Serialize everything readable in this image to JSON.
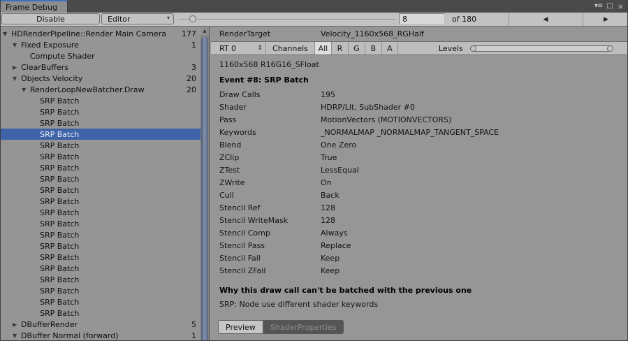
{
  "window": {
    "tab_title": "Frame Debug",
    "controls": {
      "menu": "▾≡",
      "maximize": "□",
      "close": "×"
    }
  },
  "icons": {
    "up_arrow": "▲",
    "prev": "◀",
    "next": "▶",
    "dropdown": "▾",
    "updown": "⇕"
  },
  "toolbar": {
    "disable_label": "Disable",
    "editor_label": "Editor",
    "frame_value": "8",
    "frame_total_label": "of 180",
    "slider": {
      "value": 8,
      "max": 180
    }
  },
  "tree": {
    "items": [
      {
        "label": "HDRenderPipeline::Render Main Camera",
        "count": "177",
        "level": 0,
        "arrow": "▼"
      },
      {
        "label": "Fixed Exposure",
        "count": "1",
        "level": 1,
        "arrow": "▼"
      },
      {
        "label": "Compute Shader",
        "count": "",
        "level": 2,
        "arrow": ""
      },
      {
        "label": "ClearBuffers",
        "count": "3",
        "level": 1,
        "arrow": "▶"
      },
      {
        "label": "Objects Velocity",
        "count": "20",
        "level": 1,
        "arrow": "▼"
      },
      {
        "label": "RenderLoopNewBatcher.Draw",
        "count": "20",
        "level": 2,
        "arrow": "▼"
      },
      {
        "label": "SRP Batch",
        "count": "",
        "level": 3,
        "arrow": ""
      },
      {
        "label": "SRP Batch",
        "count": "",
        "level": 3,
        "arrow": ""
      },
      {
        "label": "SRP Batch",
        "count": "",
        "level": 3,
        "arrow": ""
      },
      {
        "label": "SRP Batch",
        "count": "",
        "level": 3,
        "arrow": "",
        "selected": true
      },
      {
        "label": "SRP Batch",
        "count": "",
        "level": 3,
        "arrow": ""
      },
      {
        "label": "SRP Batch",
        "count": "",
        "level": 3,
        "arrow": ""
      },
      {
        "label": "SRP Batch",
        "count": "",
        "level": 3,
        "arrow": ""
      },
      {
        "label": "SRP Batch",
        "count": "",
        "level": 3,
        "arrow": ""
      },
      {
        "label": "SRP Batch",
        "count": "",
        "level": 3,
        "arrow": ""
      },
      {
        "label": "SRP Batch",
        "count": "",
        "level": 3,
        "arrow": ""
      },
      {
        "label": "SRP Batch",
        "count": "",
        "level": 3,
        "arrow": ""
      },
      {
        "label": "SRP Batch",
        "count": "",
        "level": 3,
        "arrow": ""
      },
      {
        "label": "SRP Batch",
        "count": "",
        "level": 3,
        "arrow": ""
      },
      {
        "label": "SRP Batch",
        "count": "",
        "level": 3,
        "arrow": ""
      },
      {
        "label": "SRP Batch",
        "count": "",
        "level": 3,
        "arrow": ""
      },
      {
        "label": "SRP Batch",
        "count": "",
        "level": 3,
        "arrow": ""
      },
      {
        "label": "SRP Batch",
        "count": "",
        "level": 3,
        "arrow": ""
      },
      {
        "label": "SRP Batch",
        "count": "",
        "level": 3,
        "arrow": ""
      },
      {
        "label": "SRP Batch",
        "count": "",
        "level": 3,
        "arrow": ""
      },
      {
        "label": "SRP Batch",
        "count": "",
        "level": 3,
        "arrow": ""
      },
      {
        "label": "DBufferRender",
        "count": "5",
        "level": 1,
        "arrow": "▶"
      },
      {
        "label": "DBuffer Normal (forward)",
        "count": "1",
        "level": 1,
        "arrow": "▼"
      }
    ]
  },
  "inspector": {
    "render_target": {
      "label": "RenderTarget",
      "value": "Velocity_1160x568_RGHalf"
    },
    "rt_toolbar": {
      "rt_select_value": "RT 0",
      "channels_label": "Channels",
      "channel_buttons": [
        {
          "label": "All",
          "active": true
        },
        {
          "label": "R"
        },
        {
          "label": "G"
        },
        {
          "label": "B"
        },
        {
          "label": "A"
        }
      ],
      "levels_label": "Levels"
    },
    "format_line": "1160x568 R16G16_SFloat",
    "event_header": "Event #8: SRP Batch",
    "details": [
      {
        "label": "Draw Calls",
        "value": "195"
      },
      {
        "label": "Shader",
        "value": "HDRP/Lit, SubShader #0"
      },
      {
        "label": "Pass",
        "value": "MotionVectors (MOTIONVECTORS)"
      },
      {
        "label": "Keywords",
        "value": "_NORMALMAP _NORMALMAP_TANGENT_SPACE"
      },
      {
        "label": "Blend",
        "value": "One Zero"
      },
      {
        "label": "ZClip",
        "value": "True"
      },
      {
        "label": "ZTest",
        "value": "LessEqual"
      },
      {
        "label": "ZWrite",
        "value": "On"
      },
      {
        "label": "Cull",
        "value": "Back"
      },
      {
        "label": "Stencil Ref",
        "value": "128"
      },
      {
        "label": "Stencil WriteMask",
        "value": "128"
      },
      {
        "label": "Stencil Comp",
        "value": "Always"
      },
      {
        "label": "Stencil Pass",
        "value": "Replace"
      },
      {
        "label": "Stencil Fail",
        "value": "Keep"
      },
      {
        "label": "Stencil ZFail",
        "value": "Keep"
      }
    ],
    "note_title": "Why this draw call can't be batched with the previous one",
    "note_body": "SRP: Node use different shader keywords",
    "bottom_tabs": [
      {
        "label": "Preview",
        "variant": "light"
      },
      {
        "label": "ShaderProperties",
        "variant": "dark"
      }
    ]
  },
  "colors": {
    "accent_tab_line": "#3e72b8",
    "selection_blue": "#3e63a8",
    "toolbar_bg": "#c2c2c2",
    "panel_bg": "#969696",
    "chrome_bg": "#4a4a4a"
  }
}
